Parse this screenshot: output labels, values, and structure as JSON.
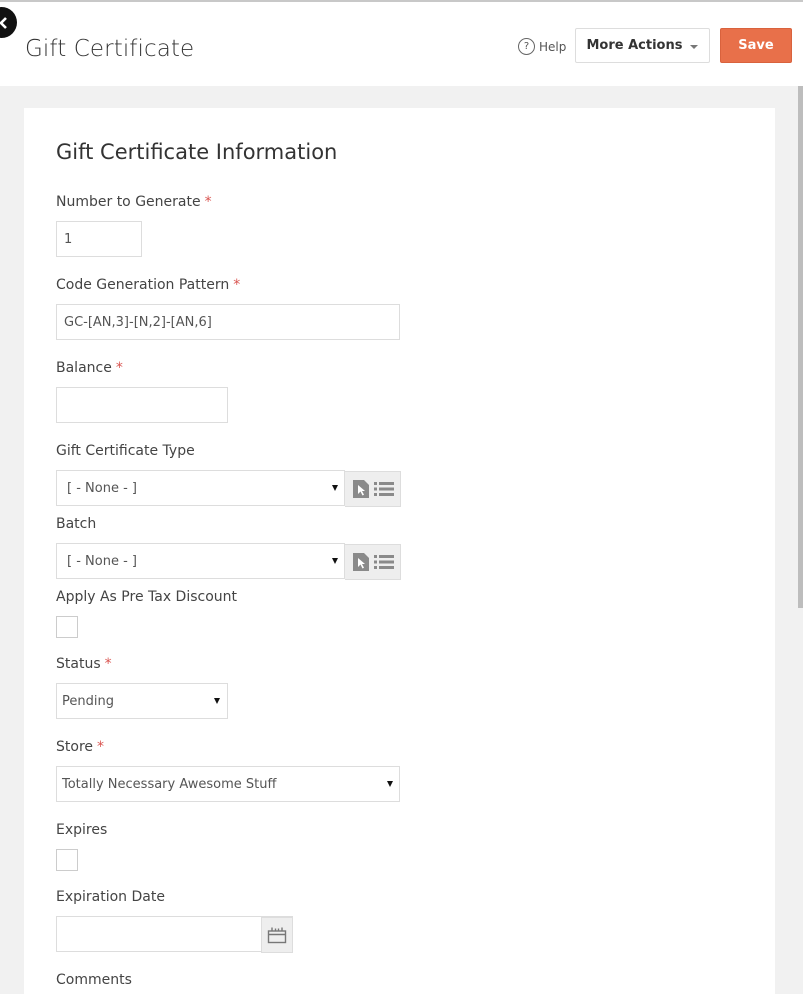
{
  "header": {
    "title": "Gift Certificate",
    "help_label": "Help",
    "more_actions_label": "More Actions",
    "save_label": "Save",
    "accent_color": "#e8704a"
  },
  "form": {
    "section_title": "Gift Certificate Information",
    "fields": {
      "number_to_generate": {
        "label": "Number to Generate",
        "required": "*",
        "value": "1"
      },
      "code_pattern": {
        "label": "Code Generation Pattern",
        "required": "*",
        "value": "GC-[AN,3]-[N,2]-[AN,6]"
      },
      "balance": {
        "label": "Balance",
        "required": "*",
        "value": ""
      },
      "gift_certificate_type": {
        "label": "Gift Certificate Type",
        "value": "[ - None - ]"
      },
      "batch": {
        "label": "Batch",
        "value": "[ - None - ]"
      },
      "apply_pre_tax": {
        "label": "Apply As Pre Tax Discount",
        "checked": false
      },
      "status": {
        "label": "Status",
        "required": "*",
        "value": "Pending"
      },
      "store": {
        "label": "Store",
        "required": "*",
        "value": "Totally Necessary Awesome Stuff"
      },
      "expires": {
        "label": "Expires",
        "checked": false
      },
      "expiration_date": {
        "label": "Expiration Date",
        "value": ""
      },
      "comments": {
        "label": "Comments"
      }
    }
  },
  "icons": {
    "back": "chevron-left-icon",
    "help": "question-circle-icon",
    "more_actions_caret": "caret-down-icon",
    "lookup": "select-record-icon",
    "list": "list-icon",
    "calendar": "calendar-icon"
  }
}
